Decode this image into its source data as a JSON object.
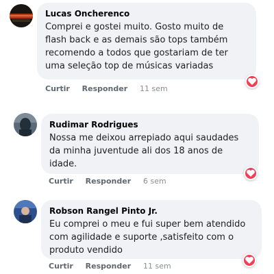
{
  "comments": [
    {
      "author": "Lucas Oncherenco",
      "lines": [
        "Comprei e gostei muito. Gosto muito de",
        "flash back e as demais são tops também",
        "recomendo a todos que gostariam de ter",
        "uma seleção top de músicas variadas"
      ],
      "like_label": "Curtir",
      "reply_label": "Responder",
      "time": "11 sem",
      "reaction": "heart-icon"
    },
    {
      "author": "Rudimar Rodrigues",
      "lines": [
        "Nossa me deixou arrepiado aqui saudades",
        "da minha juventude ali dos 18 anos de",
        "idade."
      ],
      "like_label": "Curtir",
      "reply_label": "Responder",
      "time": "6 sem",
      "reaction": "heart-icon"
    },
    {
      "author": "Robson Rangel Pinto Jr.",
      "lines": [
        "Eu comprei o meu e fui super bem atendido",
        "com agilidade e suporte ,satisfeito com o",
        "produto vendido"
      ],
      "like_label": "Curtir",
      "reply_label": "Responder",
      "time": "11 sem",
      "reaction": "heart-icon"
    }
  ],
  "colors": {
    "bubble": "#f0f2f5",
    "heart": "#f33e58",
    "action_text": "#606770"
  }
}
